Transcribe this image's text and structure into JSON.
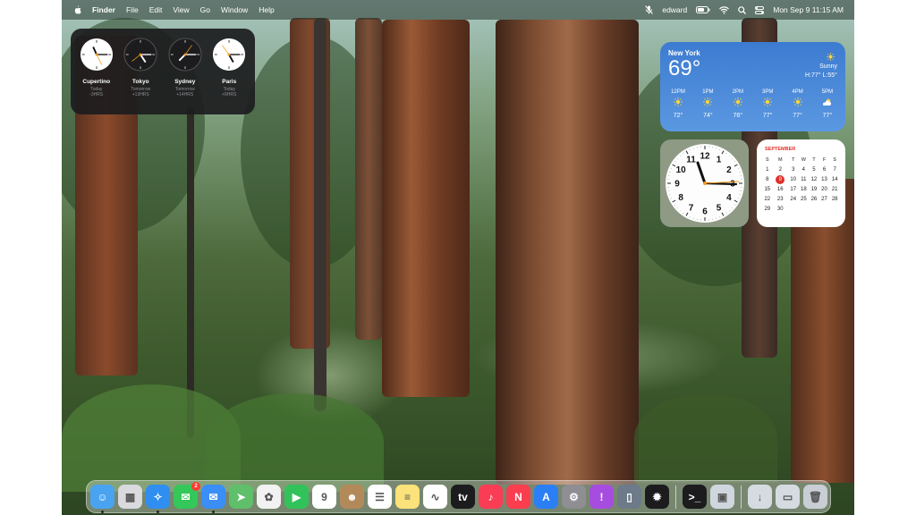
{
  "menubar": {
    "apple_icon": "apple-icon",
    "app_name": "Finder",
    "menus": [
      "File",
      "Edit",
      "View",
      "Go",
      "Window",
      "Help"
    ],
    "user": "edward",
    "datetime": "Mon Sep 9  11:15 AM"
  },
  "world_clocks": [
    {
      "city": "Cupertino",
      "day": "Today",
      "offset": "-3HRS"
    },
    {
      "city": "Tokyo",
      "day": "Tomorrow",
      "offset": "+13HRS"
    },
    {
      "city": "Sydney",
      "day": "Tomorrow",
      "offset": "+14HRS"
    },
    {
      "city": "Paris",
      "day": "Today",
      "offset": "+6HRS"
    }
  ],
  "weather": {
    "city": "New York",
    "temp": "69°",
    "condition": "Sunny",
    "high_low": "H:77° L:55°",
    "hours": [
      {
        "time": "12PM",
        "temp": "72°",
        "icon": "sun-icon"
      },
      {
        "time": "1PM",
        "temp": "74°",
        "icon": "sun-icon"
      },
      {
        "time": "2PM",
        "temp": "76°",
        "icon": "sun-icon"
      },
      {
        "time": "3PM",
        "temp": "77°",
        "icon": "sun-icon"
      },
      {
        "time": "4PM",
        "temp": "77°",
        "icon": "sun-icon"
      },
      {
        "time": "5PM",
        "temp": "77°",
        "icon": "partly-cloudy-icon"
      }
    ]
  },
  "analog_clock": {
    "numbers": [
      "12",
      "1",
      "2",
      "3",
      "4",
      "5",
      "6",
      "7",
      "8",
      "9",
      "10",
      "11"
    ],
    "time": "11:15"
  },
  "calendar": {
    "month": "SEPTEMBER",
    "weekdays": [
      "S",
      "M",
      "T",
      "W",
      "T",
      "F",
      "S"
    ],
    "weeks": [
      [
        "1",
        "2",
        "3",
        "4",
        "5",
        "6",
        "7"
      ],
      [
        "8",
        "9",
        "10",
        "11",
        "12",
        "13",
        "14"
      ],
      [
        "15",
        "16",
        "17",
        "18",
        "19",
        "20",
        "21"
      ],
      [
        "22",
        "23",
        "24",
        "25",
        "26",
        "27",
        "28"
      ],
      [
        "29",
        "30",
        "",
        "",
        "",
        "",
        ""
      ]
    ],
    "today": "9"
  },
  "dock": {
    "apps": [
      {
        "name": "Finder",
        "icon": "finder-icon",
        "color": "#4aa3f0",
        "running": true
      },
      {
        "name": "Launchpad",
        "icon": "launchpad-icon",
        "color": "#d9d9de"
      },
      {
        "name": "Safari",
        "icon": "safari-icon",
        "color": "#2f8ef0",
        "running": true
      },
      {
        "name": "Messages",
        "icon": "messages-icon",
        "color": "#34c759",
        "badge": "2"
      },
      {
        "name": "Mail",
        "icon": "mail-icon",
        "color": "#3a8ef6",
        "running": true
      },
      {
        "name": "Maps",
        "icon": "maps-icon",
        "color": "#5fbf6a"
      },
      {
        "name": "Photos",
        "icon": "photos-icon",
        "color": "#f2f2f2"
      },
      {
        "name": "FaceTime",
        "icon": "facetime-icon",
        "color": "#32c25a"
      },
      {
        "name": "Calendar",
        "icon": "calendar-icon",
        "color": "#ffffff",
        "label": "9"
      },
      {
        "name": "Contacts",
        "icon": "contacts-icon",
        "color": "#b28a5a"
      },
      {
        "name": "Reminders",
        "icon": "reminders-icon",
        "color": "#ffffff"
      },
      {
        "name": "Notes",
        "icon": "notes-icon",
        "color": "#fbe27a"
      },
      {
        "name": "Freeform",
        "icon": "freeform-icon",
        "color": "#ffffff"
      },
      {
        "name": "Apple TV",
        "icon": "tv-icon",
        "color": "#1c1c1e",
        "label": "tv"
      },
      {
        "name": "Music",
        "icon": "music-icon",
        "color": "#fa3d55"
      },
      {
        "name": "News",
        "icon": "news-icon",
        "color": "#fa3d4f"
      },
      {
        "name": "App Store",
        "icon": "app-store-icon",
        "color": "#2b7ff5"
      },
      {
        "name": "System Settings",
        "icon": "gear-icon",
        "color": "#8e8e93"
      },
      {
        "name": "Feedback",
        "icon": "feedback-icon",
        "color": "#a64de0"
      },
      {
        "name": "Simulator",
        "icon": "phone-icon",
        "color": "#6d7a8a"
      },
      {
        "name": "Bug Tracker",
        "icon": "bug-icon",
        "color": "#1c1c1e"
      }
    ],
    "persistent": [
      {
        "name": "Terminal",
        "icon": "terminal-icon",
        "color": "#1c1c1e"
      },
      {
        "name": "Preview",
        "icon": "preview-icon",
        "color": "#d0d6de"
      }
    ],
    "trash_group": [
      {
        "name": "Downloads",
        "icon": "downloads-icon",
        "color": "#d6dbe1"
      },
      {
        "name": "Documents",
        "icon": "documents-icon",
        "color": "#d6dbe1"
      },
      {
        "name": "Trash",
        "icon": "trash-icon",
        "color": "#c9ced5"
      }
    ]
  }
}
